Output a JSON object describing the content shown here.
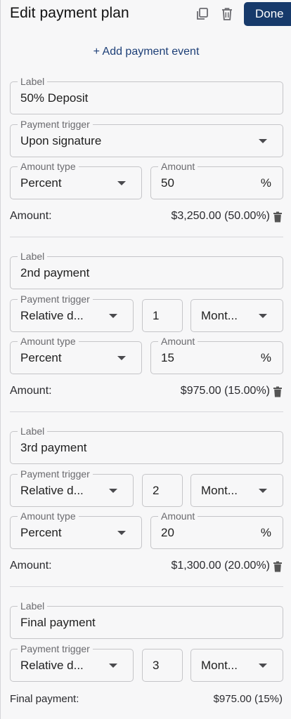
{
  "header": {
    "title": "Edit payment plan",
    "done_label": "Done"
  },
  "add_event_label": "+ Add payment event",
  "events": [
    {
      "label_title": "Label",
      "label_value": "50% Deposit",
      "trigger_title": "Payment trigger",
      "trigger_value": "Upon signature",
      "amount_type_title": "Amount type",
      "amount_type_value": "Percent",
      "amount_title": "Amount",
      "amount_value": "50",
      "amount_suffix": "%",
      "summary_label": "Amount:",
      "summary_value": "$3,250.00 (50.00%)"
    },
    {
      "label_title": "Label",
      "label_value": "2nd payment",
      "trigger_title": "Payment trigger",
      "trigger_value": "Relative d...",
      "offset_value": "1",
      "unit_value": "Mont...",
      "amount_type_title": "Amount type",
      "amount_type_value": "Percent",
      "amount_title": "Amount",
      "amount_value": "15",
      "amount_suffix": "%",
      "summary_label": "Amount:",
      "summary_value": "$975.00 (15.00%)"
    },
    {
      "label_title": "Label",
      "label_value": "3rd payment",
      "trigger_title": "Payment trigger",
      "trigger_value": "Relative d...",
      "offset_value": "2",
      "unit_value": "Mont...",
      "amount_type_title": "Amount type",
      "amount_type_value": "Percent",
      "amount_title": "Amount",
      "amount_value": "20",
      "amount_suffix": "%",
      "summary_label": "Amount:",
      "summary_value": "$1,300.00 (20.00%)"
    },
    {
      "label_title": "Label",
      "label_value": "Final payment",
      "trigger_title": "Payment trigger",
      "trigger_value": "Relative d...",
      "offset_value": "3",
      "unit_value": "Mont...",
      "summary_label": "Final payment:",
      "summary_value": "$975.00 (15%)"
    }
  ],
  "icons": {
    "copy": "copy-icon",
    "trash": "trash-icon",
    "dropdown": "chevron-down-icon"
  },
  "colors": {
    "primary": "#173a6b",
    "link": "#1d3f77",
    "border": "#c5c5c8",
    "background": "#f7f7f8"
  }
}
